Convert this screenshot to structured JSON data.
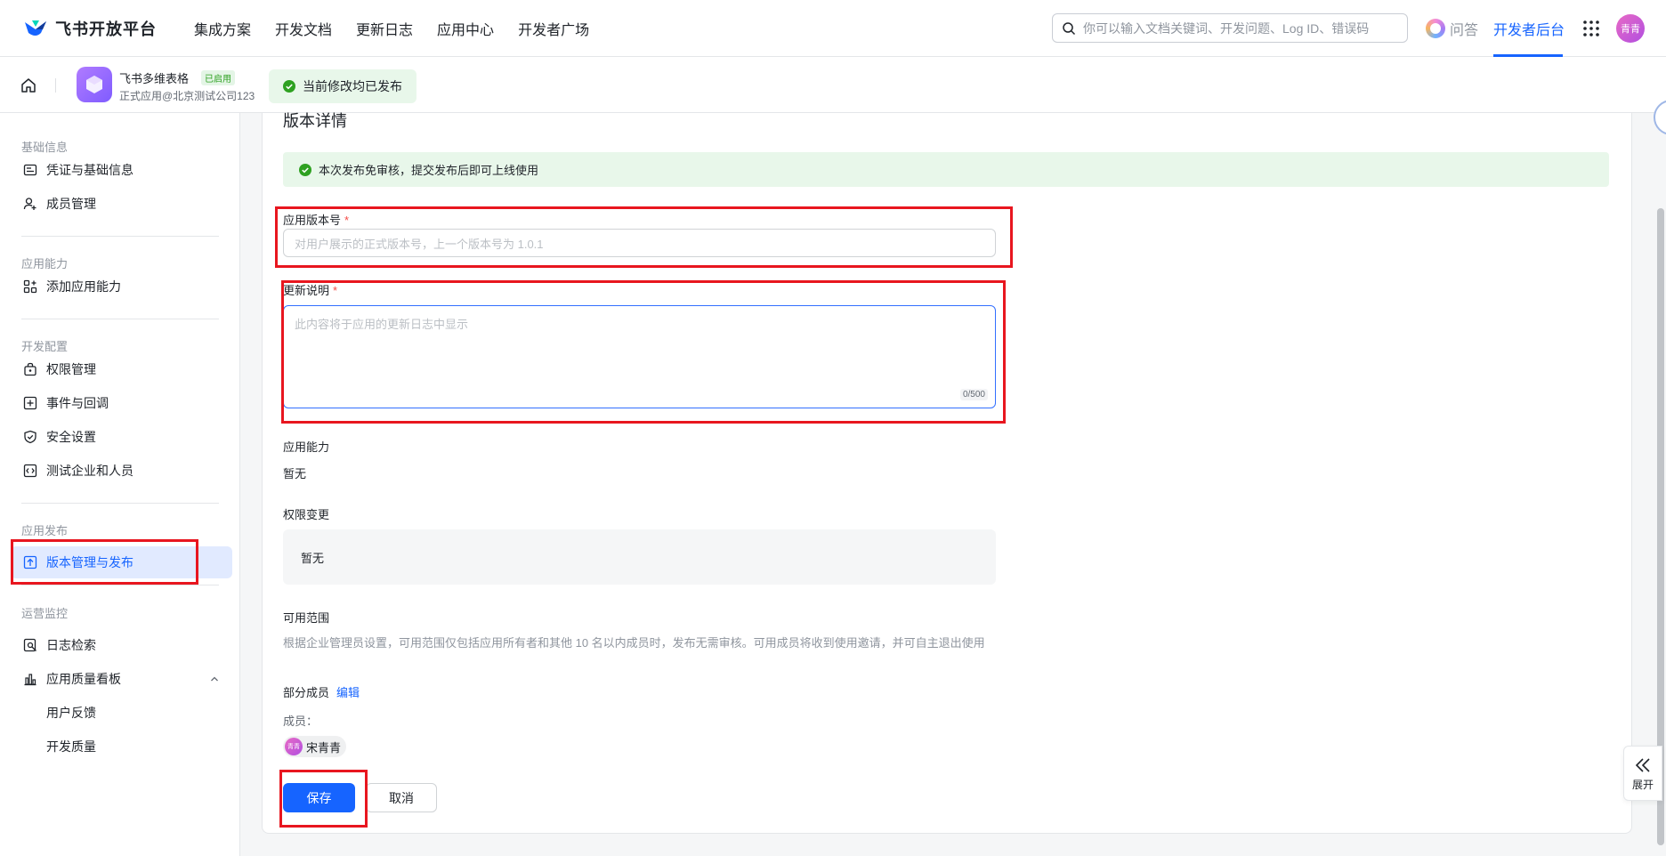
{
  "topbar": {
    "brand": "飞书开放平台",
    "nav": [
      "集成方案",
      "开发文档",
      "更新日志",
      "应用中心",
      "开发者广场"
    ],
    "search_placeholder": "你可以输入文档关键词、开发问题、Log ID、错误码",
    "qa_label": "问答",
    "dev_console_label": "开发者后台",
    "user_avatar_text": "青青"
  },
  "appbar": {
    "app_name": "飞书多维表格",
    "app_badge": "已启用",
    "app_sub": "正式应用@北京测试公司123",
    "publish_status": "当前修改均已发布"
  },
  "sidebar": {
    "groups": {
      "basic": "基础信息",
      "ability": "应用能力",
      "dev": "开发配置",
      "release": "应用发布",
      "ops": "运营监控"
    },
    "items": {
      "credentials": "凭证与基础信息",
      "members": "成员管理",
      "add_ability": "添加应用能力",
      "permissions": "权限管理",
      "events": "事件与回调",
      "security": "安全设置",
      "test_org": "测试企业和人员",
      "version": "版本管理与发布",
      "logs": "日志检索",
      "quality": "应用质量看板",
      "feedback": "用户反馈",
      "dev_quality": "开发质量"
    }
  },
  "main": {
    "section_title": "版本详情",
    "notice": "本次发布免审核，提交发布后即可上线使用",
    "version_label": "应用版本号",
    "required_mark": "*",
    "version_placeholder": "对用户展示的正式版本号，上一个版本号为 1.0.1",
    "notes_label": "更新说明",
    "notes_placeholder": "此内容将于应用的更新日志中显示",
    "notes_counter": "0/500",
    "ability_label": "应用能力",
    "ability_value": "暂无",
    "perm_label": "权限变更",
    "perm_value": "暂无",
    "scope_label": "可用范围",
    "scope_desc": "根据企业管理员设置，可用范围仅包括应用所有者和其他 10 名以内成员时，发布无需审核。可用成员将收到使用邀请，并可自主退出使用",
    "scope_type": "部分成员",
    "edit_label": "编辑",
    "members_label": "成员：",
    "member_avatar_text": "青青",
    "member_name": "宋青青",
    "save_label": "保存",
    "cancel_label": "取消"
  },
  "float": {
    "expand_label": "展开"
  },
  "colors": {
    "accent": "#1664ff",
    "success_bg": "#e8f7ea",
    "annotation_red": "#e8161f"
  }
}
